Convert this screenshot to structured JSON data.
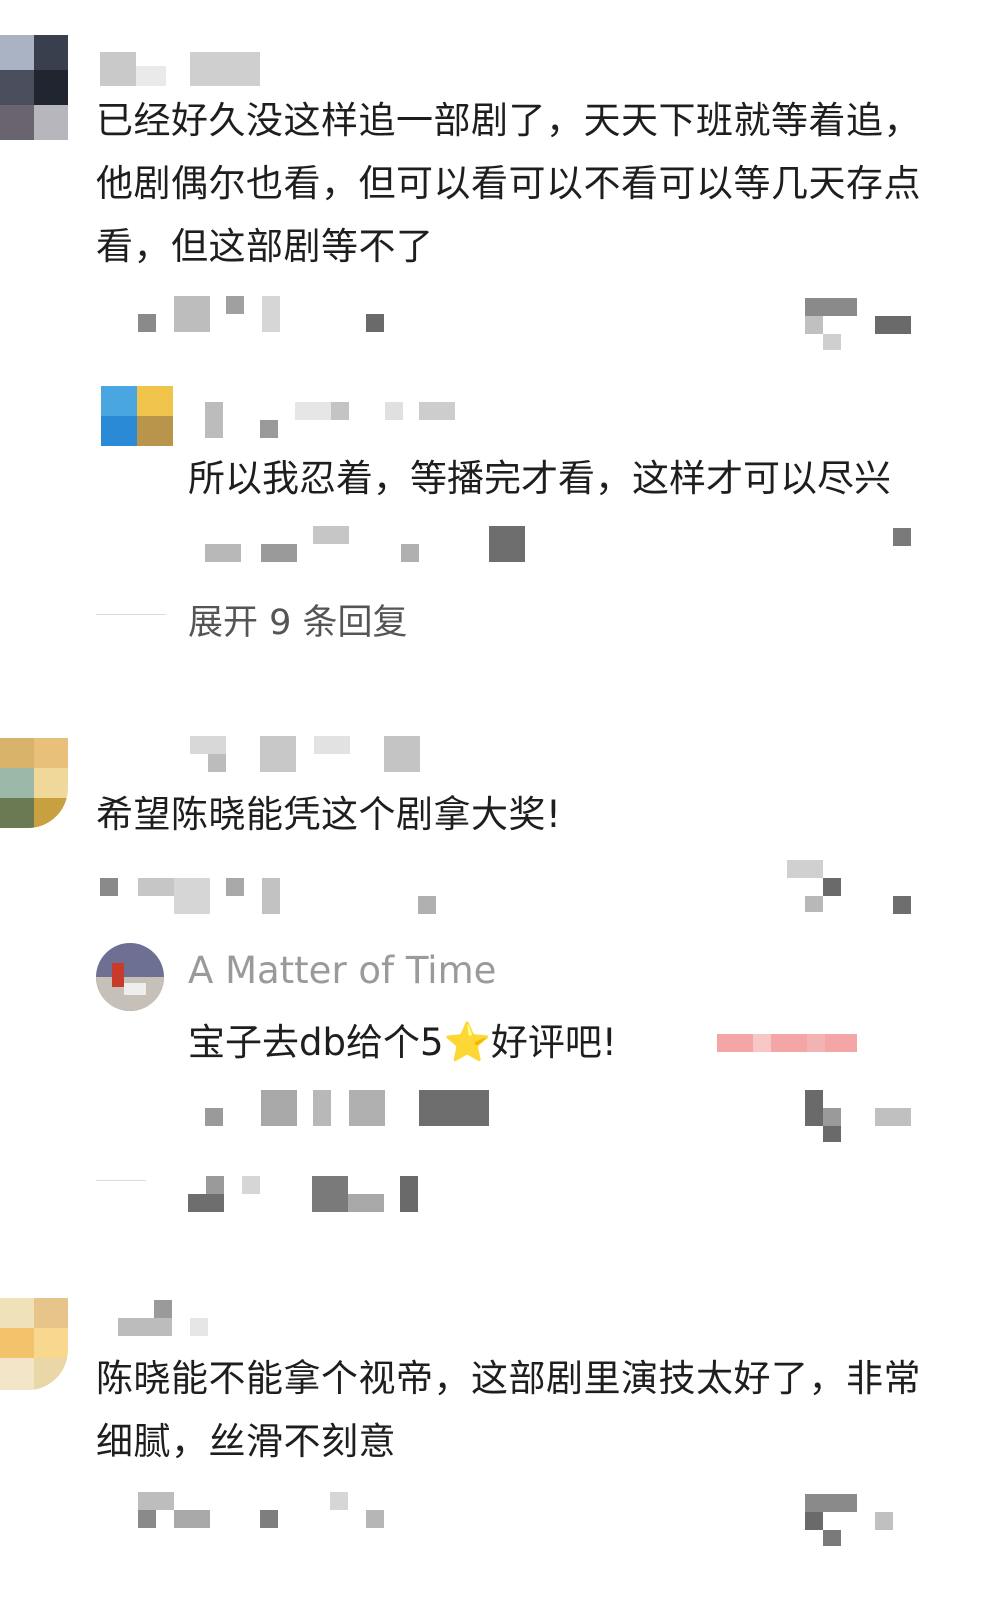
{
  "comments": [
    {
      "lines": [
        "已经好久没这样追一部剧了，天天下班就等着追，",
        "他剧偶尔也看，但可以看可以不看可以等几天存点",
        "看，但这部剧等不了"
      ],
      "replies": [
        {
          "text": "所以我忍着，等播完才看，这样才可以尽兴"
        }
      ],
      "expand_label": "展开 9 条回复"
    },
    {
      "lines": [
        "希望陈晓能凭这个剧拿大奖!"
      ],
      "replies": [
        {
          "name": "A Matter of Time",
          "text_before": "宝子去db给个5",
          "star": "⭐",
          "text_after": "好评吧!"
        }
      ]
    },
    {
      "lines": [
        "陈晓能不能拿个视帝，这部剧里演技太好了，非常",
        "细腻，丝滑不刻意"
      ]
    }
  ],
  "icons": [
    "star-icon"
  ],
  "colors": {
    "divider": "#dcdcdc",
    "reply_name": "#9a9a9a",
    "expand_text": "#555555",
    "highlight": "#f4a6a6"
  }
}
